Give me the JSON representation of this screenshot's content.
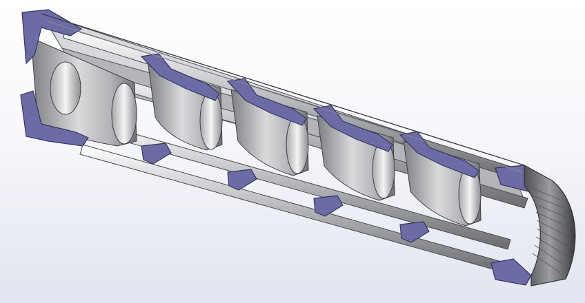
{
  "viewport": {
    "background_top": "#ffffff",
    "background_bottom": "#e2e5ef"
  },
  "model": {
    "section_face_color": "#6b6ba6",
    "section_face_edge": "#3d3d6e",
    "body_color": "#b9babd",
    "body_shadow": "#6e7074",
    "body_highlight": "#ebecee",
    "baffle_count": 5,
    "rail_count": 4
  }
}
